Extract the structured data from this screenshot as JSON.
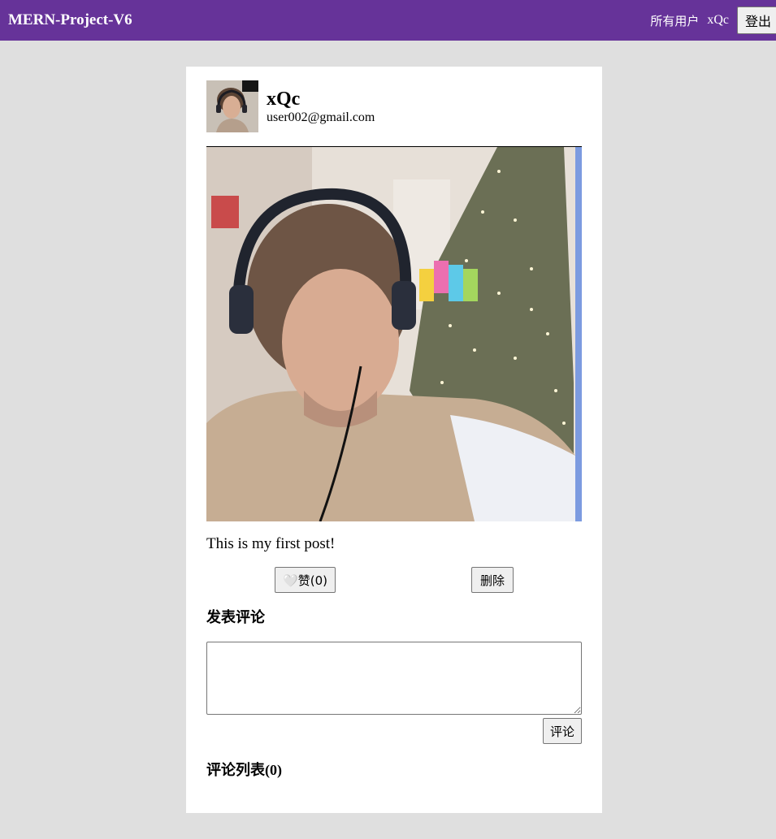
{
  "navbar": {
    "brand": "MERN-Project-V6",
    "all_users_link": "所有用户",
    "current_user": "xQc",
    "logout_label": "登出"
  },
  "post": {
    "author": {
      "name": "xQc",
      "email": "user002@gmail.com"
    },
    "text": "This is my first post!",
    "like_label": "赞(0)",
    "like_icon": "🤍",
    "delete_label": "删除"
  },
  "comments": {
    "form_title": "发表评论",
    "input_value": "",
    "submit_label": "评论",
    "list_title": "评论列表",
    "list_count": "(0)"
  },
  "colors": {
    "navbar": "#663399",
    "page_background": "#dfdfdf",
    "card_background": "#ffffff"
  }
}
